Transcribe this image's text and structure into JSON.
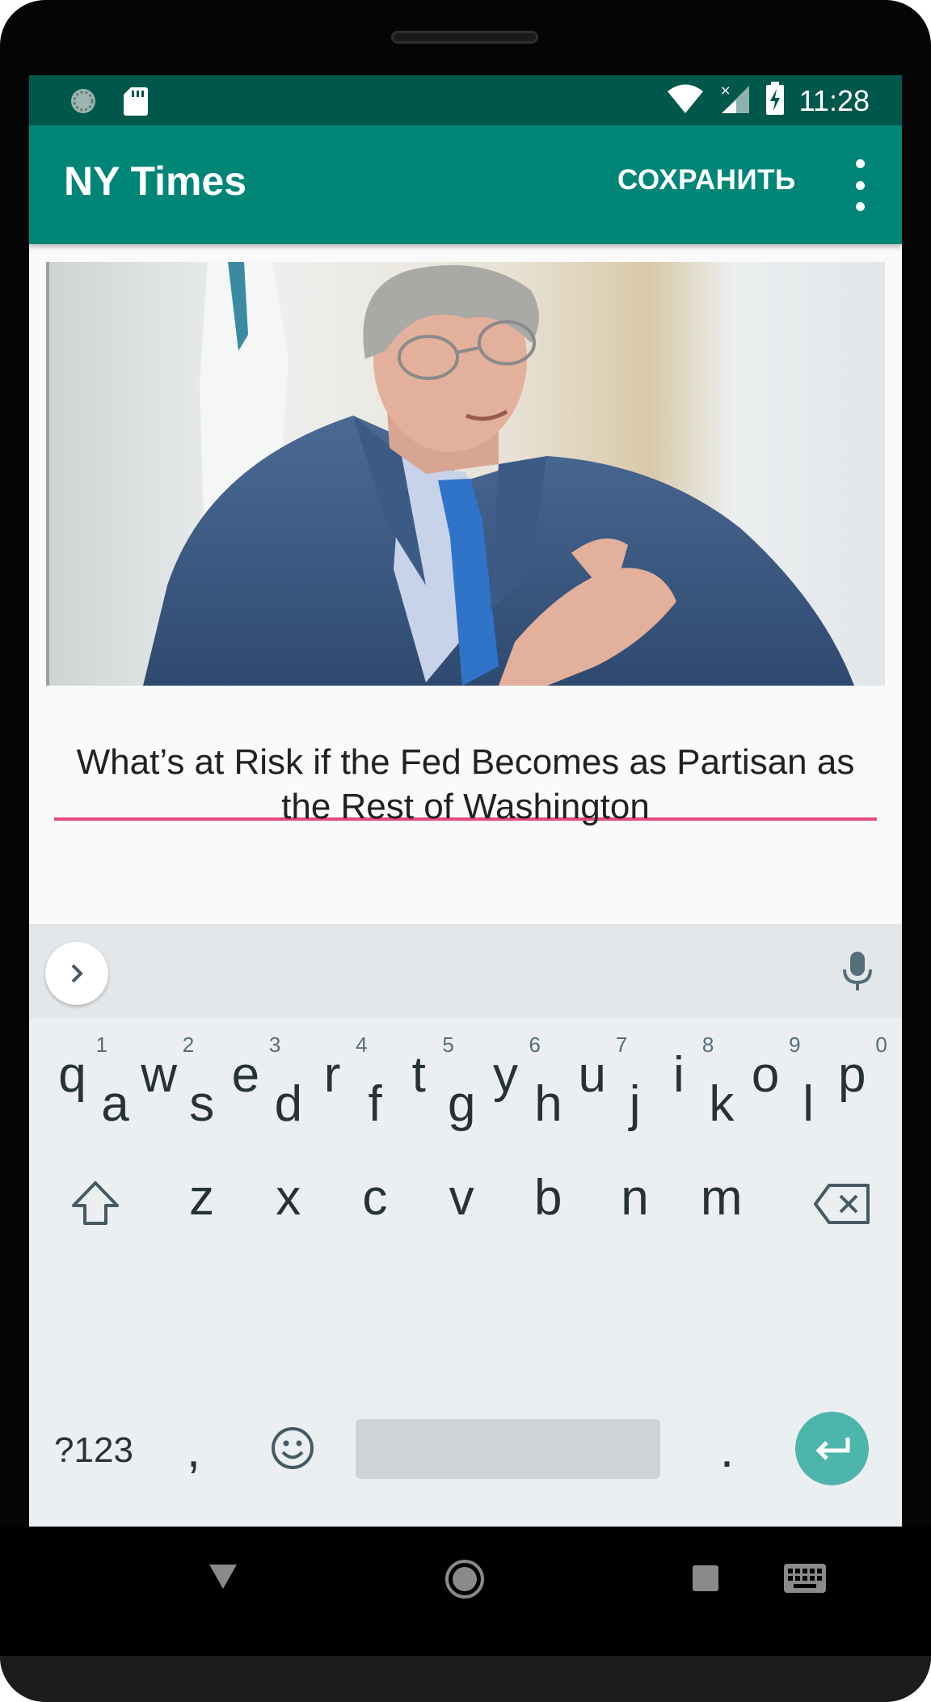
{
  "status_bar": {
    "time": "11:28",
    "icons": [
      "sync-icon",
      "sd-card-icon",
      "wifi-icon",
      "no-signal-icon",
      "battery-charging-icon"
    ]
  },
  "app_bar": {
    "title": "NY Times",
    "save_label": "СОХРАНИТЬ",
    "overflow_icon": "more-vert-icon"
  },
  "article": {
    "image_icon": "photo-man-in-suit",
    "headline": "What’s at Risk if the Fed Becomes as Partisan as the Rest of Washington"
  },
  "keyboard": {
    "row1": [
      {
        "key": "q",
        "hint": "1"
      },
      {
        "key": "w",
        "hint": "2"
      },
      {
        "key": "e",
        "hint": "3"
      },
      {
        "key": "r",
        "hint": "4"
      },
      {
        "key": "t",
        "hint": "5"
      },
      {
        "key": "y",
        "hint": "6"
      },
      {
        "key": "u",
        "hint": "7"
      },
      {
        "key": "i",
        "hint": "8"
      },
      {
        "key": "o",
        "hint": "9"
      },
      {
        "key": "p",
        "hint": "0"
      }
    ],
    "row2": [
      "a",
      "s",
      "d",
      "f",
      "g",
      "h",
      "j",
      "k",
      "l"
    ],
    "row3": [
      "z",
      "x",
      "c",
      "v",
      "b",
      "n",
      "m"
    ],
    "symbols_label": "?123",
    "comma_label": ",",
    "period_label": ".",
    "accent_color": "#4db6ac"
  },
  "colors": {
    "status_bar": "#00574b",
    "app_bar": "#008577",
    "field_underline": "#e4497f"
  }
}
